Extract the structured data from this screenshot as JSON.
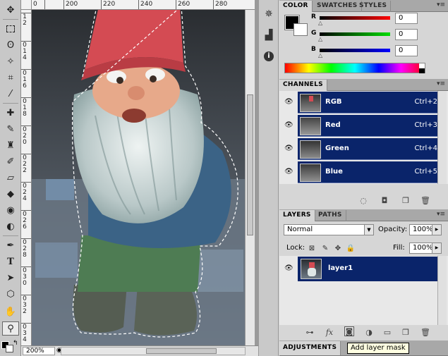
{
  "document": {
    "zoom": "200%",
    "ruler_top_labels": [
      "0",
      "200",
      "220",
      "240",
      "260",
      "280"
    ],
    "ruler_left_labels": [
      "1",
      "2",
      "0",
      "1",
      "4",
      "0",
      "1",
      "6",
      "0",
      "1",
      "8",
      "0",
      "2",
      "0",
      "0",
      "2",
      "2",
      "0",
      "2",
      "4",
      "0",
      "2",
      "6",
      "0",
      "2",
      "8",
      "0",
      "3",
      "0",
      "0",
      "3",
      "2",
      "0",
      "3",
      "4",
      "0"
    ]
  },
  "color_panel": {
    "tabs": [
      "COLOR",
      "SWATCHES",
      "STYLES"
    ],
    "channels": [
      {
        "label": "R",
        "value": "0",
        "color": "#ff0000"
      },
      {
        "label": "G",
        "value": "0",
        "color": "#00cc00"
      },
      {
        "label": "B",
        "value": "0",
        "color": "#0000ff"
      }
    ],
    "foreground": "#000000",
    "background": "#ffffff"
  },
  "channels_panel": {
    "title": "CHANNELS",
    "items": [
      {
        "name": "RGB",
        "shortcut": "Ctrl+2"
      },
      {
        "name": "Red",
        "shortcut": "Ctrl+3"
      },
      {
        "name": "Green",
        "shortcut": "Ctrl+4"
      },
      {
        "name": "Blue",
        "shortcut": "Ctrl+5"
      }
    ]
  },
  "layers_panel": {
    "tabs": [
      "LAYERS",
      "PATHS"
    ],
    "blend_mode": "Normal",
    "opacity_label": "Opacity:",
    "opacity": "100%",
    "lock_label": "Lock:",
    "fill_label": "Fill:",
    "fill": "100%",
    "layers": [
      {
        "name": "layer1"
      }
    ]
  },
  "adjustments_panel": {
    "title": "ADJUSTMENTS"
  },
  "tooltip": "Add layer mask",
  "accent_color": "#0a246a"
}
